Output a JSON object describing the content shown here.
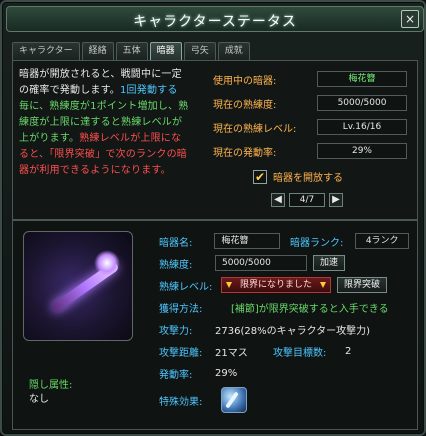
{
  "window": {
    "title": "キャラクターステータス",
    "close_label": "×"
  },
  "tabs": [
    {
      "label": "キャラクター"
    },
    {
      "label": "経絡"
    },
    {
      "label": "五体"
    },
    {
      "label": "暗器"
    },
    {
      "label": "弓矢"
    },
    {
      "label": "成就"
    }
  ],
  "description": {
    "line1": "暗器が開放されると、戦闘中に一定",
    "line2": "の確率で発動します。",
    "line2b": "1回発動する",
    "line3": "毎に、熟練度が1ポイント増加し、熟",
    "line4": "練度が上限に達すると熟練レベルが",
    "line5": "上がります。",
    "line5b": "熟練レベルが上限にな",
    "line6": "ると、「限界突破」で次のランクの暗",
    "line7": "器が利用できるようになります。"
  },
  "stats": [
    {
      "label": "使用中の暗器:",
      "value": "梅花簪"
    },
    {
      "label": "現在の熟練度:",
      "value": "5000/5000"
    },
    {
      "label": "現在の熟練レベル:",
      "value": "Lv.16/16"
    },
    {
      "label": "現在の発動率:",
      "value": "29%"
    }
  ],
  "open": {
    "checkbox_mark": "✔",
    "label": "暗器を開放する"
  },
  "pager": {
    "left": "◀",
    "page": "4/7",
    "right": "▶"
  },
  "details": {
    "name_label": "暗器名:",
    "name_value": "梅花簪",
    "rank_label": "暗器ランク:",
    "rank_value": "4ランク",
    "prof_label": "熟練度:",
    "prof_value": "5000/5000",
    "speed_button": "加速",
    "level_label": "熟練レベル:",
    "limit_text": "限界になりました",
    "breakthrough_button": "限界突破",
    "method_label": "獲得方法:",
    "method_value": "[補節]が限界突破すると入手できる",
    "attack_label": "攻撃力:",
    "attack_value": "2736(28%のキャラクター攻撃力)",
    "distance_label": "攻撃距離:",
    "distance_value": "21マス",
    "targets_label": "攻撃目標数:",
    "targets_value": "2",
    "rate_label": "発動率:",
    "rate_value": "29%",
    "effect_label": "特殊効果:"
  },
  "hidden_attribute": {
    "label": "隠し属性:",
    "value": "なし"
  }
}
